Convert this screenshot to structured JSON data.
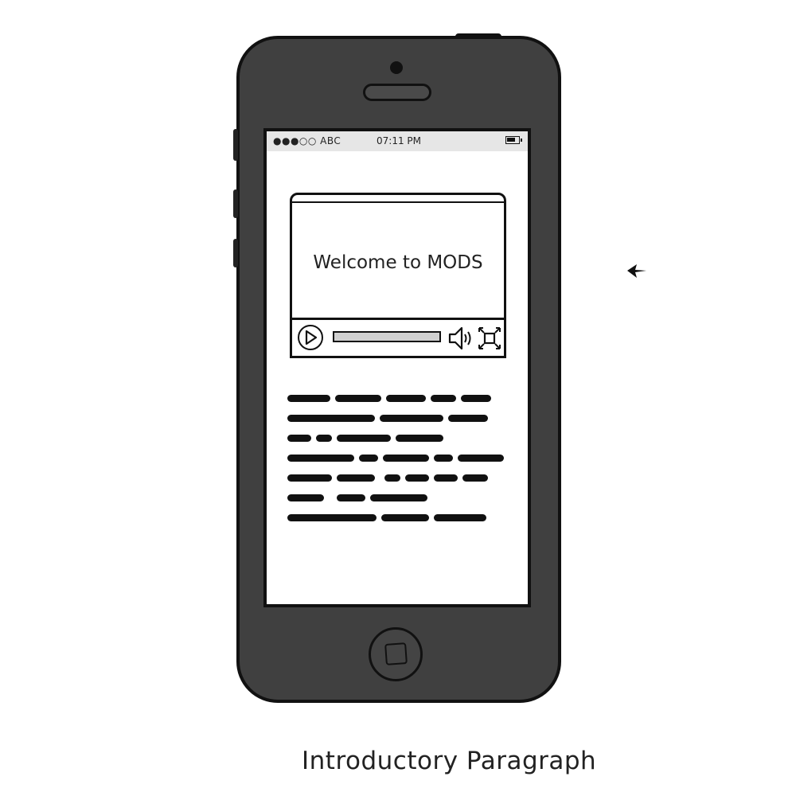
{
  "status_bar": {
    "carrier": "●●●○○ ABC",
    "time": "07:11 PM",
    "battery_icon": "battery-icon"
  },
  "video": {
    "title": "Welcome to MODS",
    "progress": 0,
    "icons": [
      "play-icon",
      "volume-icon",
      "fullscreen-icon"
    ]
  },
  "paragraph": {
    "placeholder": "scribbled text lines",
    "line_count": 7
  },
  "caption": "Introductory Paragraph",
  "colors": {
    "phone_body": "#404040",
    "outline": "#111111",
    "screen": "#ffffff",
    "status_bar": "#e6e6e6"
  }
}
